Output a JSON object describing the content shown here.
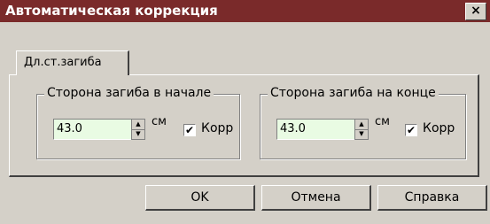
{
  "window": {
    "title": "Автоматическая коррекция",
    "close_glyph": "×"
  },
  "tabs": [
    {
      "label": "Дл.ст.загиба"
    }
  ],
  "groups": [
    {
      "title": "Сторона загиба в начале",
      "value": "43.0",
      "unit": "см",
      "check_label": "Корр",
      "checked": true
    },
    {
      "title": "Сторона загиба на конце",
      "value": "43.0",
      "unit": "см",
      "check_label": "Корр",
      "checked": true
    }
  ],
  "glyphs": {
    "check": "✔",
    "spin_up": "▲",
    "spin_down": "▼"
  },
  "buttons": {
    "ok": "OK",
    "cancel": "Отмена",
    "help": "Справка"
  },
  "colors": {
    "titlebar": "#7a2a2a",
    "input_bg": "#e9fbe3",
    "dialog_bg": "#d4d0c8"
  }
}
